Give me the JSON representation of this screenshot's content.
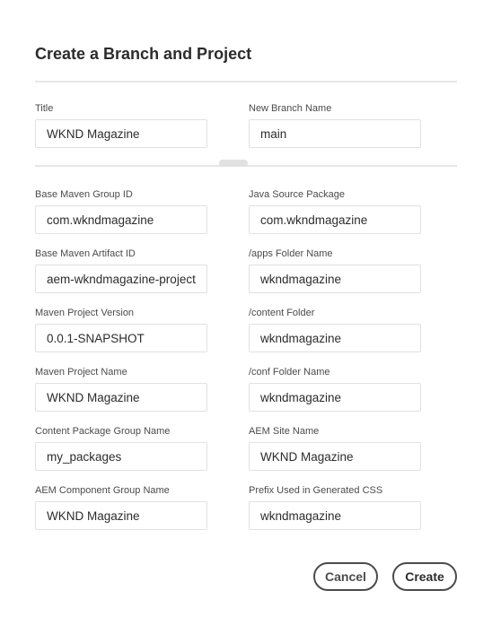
{
  "dialog": {
    "title": "Create a Branch and Project"
  },
  "branch_section": {
    "title_field": {
      "label": "Title",
      "value": "WKND Magazine"
    },
    "branch_field": {
      "label": "New Branch Name",
      "value": "main"
    }
  },
  "project_fields": {
    "left": [
      {
        "label": "Base Maven Group ID",
        "value": "com.wkndmagazine"
      },
      {
        "label": "Base Maven Artifact ID",
        "value": "aem-wkndmagazine-project"
      },
      {
        "label": "Maven Project Version",
        "value": "0.0.1-SNAPSHOT"
      },
      {
        "label": "Maven Project Name",
        "value": "WKND Magazine"
      },
      {
        "label": "Content Package Group Name",
        "value": "my_packages"
      },
      {
        "label": "AEM Component Group Name",
        "value": "WKND Magazine"
      }
    ],
    "right": [
      {
        "label": "Java Source Package",
        "value": "com.wkndmagazine"
      },
      {
        "label": "/apps Folder Name",
        "value": "wkndmagazine"
      },
      {
        "label": "/content Folder",
        "value": "wkndmagazine"
      },
      {
        "label": "/conf Folder Name",
        "value": "wkndmagazine"
      },
      {
        "label": "AEM Site Name",
        "value": "WKND Magazine"
      },
      {
        "label": "Prefix Used in Generated CSS",
        "value": "wkndmagazine"
      }
    ]
  },
  "actions": {
    "cancel_label": "Cancel",
    "create_label": "Create"
  }
}
